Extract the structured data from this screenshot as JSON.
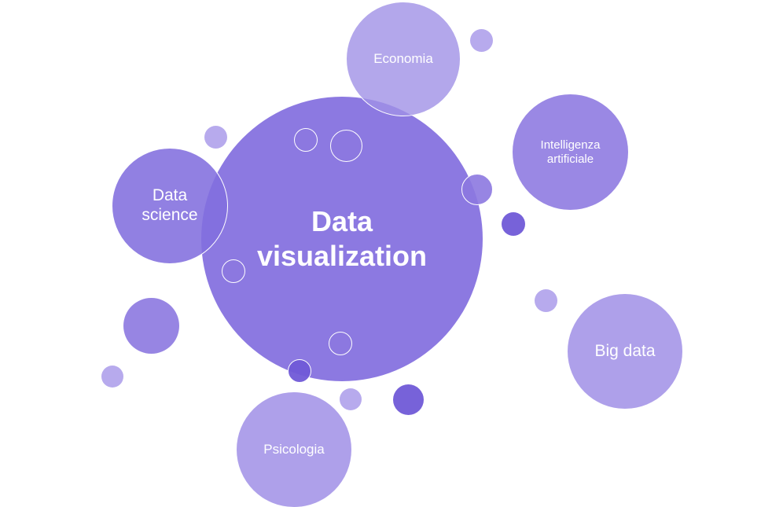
{
  "diagram": {
    "center": {
      "label": "Data visualization",
      "color": "#806ade"
    },
    "topics": [
      {
        "id": "economia",
        "label": "Economia"
      },
      {
        "id": "intelligenza-artificiale",
        "label": "Intelligenza artificiale"
      },
      {
        "id": "data-science",
        "label": "Data science"
      },
      {
        "id": "big-data",
        "label": "Big data"
      },
      {
        "id": "psicologia",
        "label": "Psicologia"
      }
    ],
    "colors": {
      "light": "#aa9bea",
      "mid": "#8c78e0",
      "dark": "#705ad7",
      "background": "#ffffff"
    }
  }
}
